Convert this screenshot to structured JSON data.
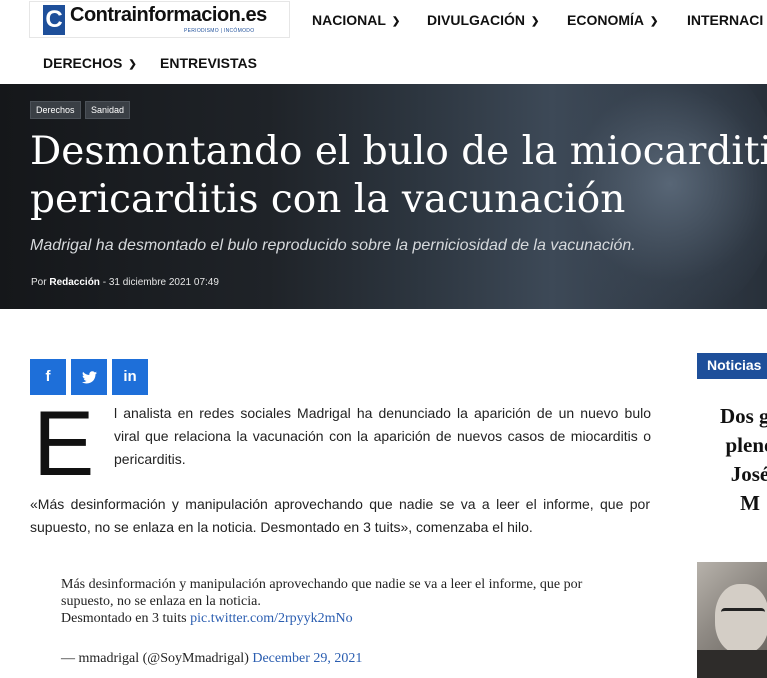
{
  "site": {
    "logo_letter": "C",
    "logo_name": "Contrainformacion.es",
    "logo_tagline": "PERIODISMO | INCÓMODO"
  },
  "nav": {
    "items": [
      {
        "label": "NACIONAL",
        "has_dropdown": true
      },
      {
        "label": "DIVULGACIÓN",
        "has_dropdown": true
      },
      {
        "label": "ECONOMÍA",
        "has_dropdown": true
      },
      {
        "label": "INTERNACI",
        "has_dropdown": false
      },
      {
        "label": "DERECHOS",
        "has_dropdown": true
      },
      {
        "label": "ENTREVISTAS",
        "has_dropdown": false
      }
    ]
  },
  "hero": {
    "tags": [
      "Derechos",
      "Sanidad"
    ],
    "title_line1": "Desmontando el bulo de la miocarditis o",
    "title_line2": "pericarditis con la vacunación",
    "subtitle": "Madrigal ha desmontado el bulo reproducido sobre la perniciosidad de la vacunación.",
    "by_prefix": "Por",
    "author": "Redacción",
    "separator": "-",
    "date": "31 diciembre 2021 07:49"
  },
  "share": {
    "facebook": "f",
    "twitter": "🐦",
    "linkedin": "in"
  },
  "article": {
    "dropcap": "E",
    "p1": "l analista en redes sociales Madrigal ha denunciado la aparición de un nuevo bulo viral que relaciona la vacunación con la aparición de nuevos casos de miocarditis o pericarditis.",
    "p2": "«Más desinformación y manipulación aprovechando que nadie se va a leer el informe, que por supuesto, no se enlaza en la noticia. Desmontado en 3 tuits», comenzaba el hilo.",
    "tweet_text": "Más desinformación y manipulación aprovechando que nadie se va a leer el informe, que por supuesto, no se enlaza en la noticia.",
    "tweet_text2": "Desmontado en 3 tuits",
    "tweet_link": "pic.twitter.com/2rpyyk2mNo",
    "tweet_author": "— mmadrigal (@SoyMmadrigal)",
    "tweet_date": "December 29, 2021"
  },
  "sidebar": {
    "header": "Noticias",
    "headline_lines": [
      "Dos go",
      "pleno",
      "José",
      "M"
    ]
  },
  "colors": {
    "accent": "#1e4f9a",
    "share_blue": "#1e6fd9",
    "link": "#2a5db0"
  }
}
